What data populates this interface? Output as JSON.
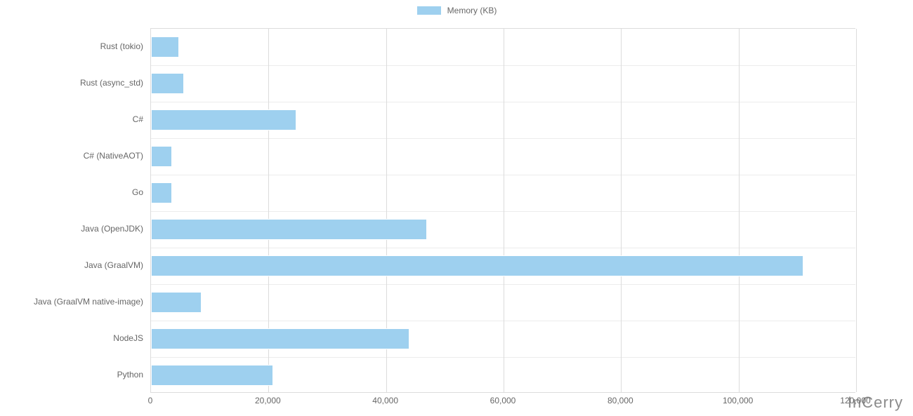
{
  "legend_label": "Memory (KB)",
  "watermark": "InCerry",
  "chart_data": {
    "type": "bar",
    "orientation": "horizontal",
    "series_name": "Memory (KB)",
    "categories": [
      "Rust (tokio)",
      "Rust (async_std)",
      "C#",
      "C# (NativeAOT)",
      "Go",
      "Java (OpenJDK)",
      "Java (GraalVM)",
      "Java (GraalVM native-image)",
      "NodeJS",
      "Python"
    ],
    "values": [
      4800,
      5600,
      24800,
      3600,
      3600,
      47000,
      111000,
      8600,
      44000,
      20800
    ],
    "x_ticks": [
      0,
      20000,
      40000,
      60000,
      80000,
      100000,
      120000
    ],
    "x_tick_labels": [
      "0",
      "20,000",
      "40,000",
      "60,000",
      "80,000",
      "100,000",
      "120,000"
    ],
    "xlim": [
      0,
      120000
    ],
    "title": "",
    "xlabel": "",
    "ylabel": "",
    "colors": {
      "bar": "#9ed0ef"
    }
  }
}
